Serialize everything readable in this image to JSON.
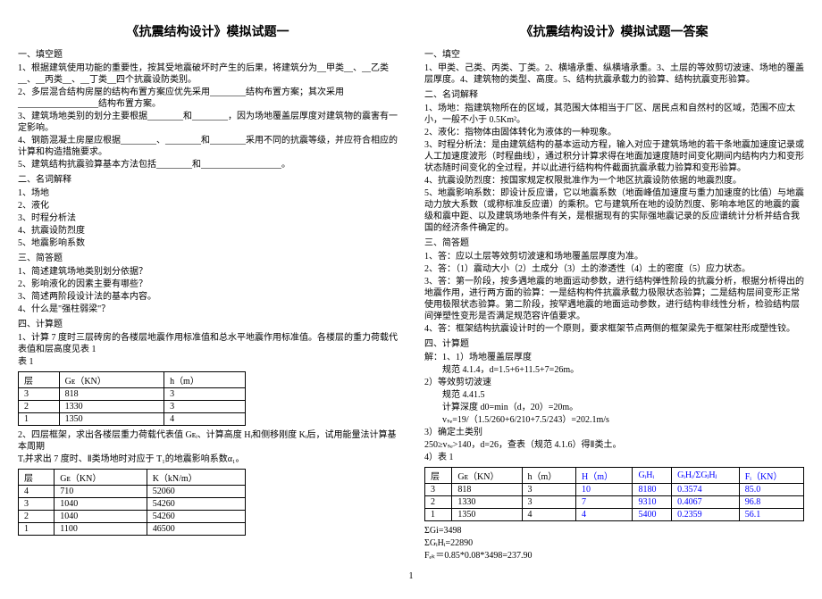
{
  "left": {
    "title": "《抗震结构设计》模拟试题一",
    "s1_title": "一、填空题",
    "q1_1": "1、根据建筑使用功能的重要性，按其受地震破坏时产生的后果，将建筑分为__甲类__、__乙类__、__丙类__、__丁类__四个抗震设防类别。",
    "q1_2": "2、多层混合结构房屋的结构布置方案应优先采用________结构布置方案；其次采用__________________结构布置方案。",
    "q1_3": "3、建筑场地类别的划分主要根据________和________，因为场地覆盖层厚度对建筑物的震害有一定影响。",
    "q1_4": "4、钢筋混凝土房屋应根据________、________和________采用不同的抗震等级，并应符合相应的计算和构造措施要求。",
    "q1_5": "5、建筑结构抗震验算基本方法包括________和__________________。",
    "s2_title": "二、名词解释",
    "q2_1": "1、场地",
    "q2_2": "2、液化",
    "q2_3": "3、时程分析法",
    "q2_4": "4、抗震设防烈度",
    "q2_5": "5、地震影响系数",
    "s3_title": "三、简答题",
    "q3_1": "1、简述建筑场地类别划分依据？",
    "q3_2": "2、影响液化的因素主要有哪些？",
    "q3_3": "3、简述两阶段设计法的基本内容。",
    "q3_4": "4、什么是\"强柱弱梁\"？",
    "s4_title": "四、计算题",
    "q4_1": "1、计算 7 度时三层砖房的各楼层地震作用标准值和总水平地震作用标准值。各楼层的重力荷载代表值和层高度见表 1",
    "t1_caption": "表 1",
    "table1": {
      "headers": [
        "层",
        "Gᴇ（KN）",
        "h（m）"
      ],
      "rows": [
        [
          "3",
          "818",
          "3"
        ],
        [
          "2",
          "1330",
          "3"
        ],
        [
          "1",
          "1350",
          "4"
        ]
      ]
    },
    "q4_2a": "2、四层框架，求出各楼层重力荷载代表值 Gᴇᵢ、计算高度 Hᵢ和侧移刚度 Kᵢ后，试用能量法计算基本周期",
    "q4_2b": "Tᵢ并求出 7 度时、Ⅱ类场地时对应于 T₁的地震影响系数α₁。",
    "table2": {
      "headers": [
        "层",
        "Gᴇ（KN）",
        "K（kN/m）"
      ],
      "rows": [
        [
          "4",
          "710",
          "52060"
        ],
        [
          "3",
          "1040",
          "54260"
        ],
        [
          "2",
          "1040",
          "54260"
        ],
        [
          "1",
          "1100",
          "46500"
        ]
      ]
    }
  },
  "right": {
    "title": "《抗震结构设计》模拟试题一答案",
    "s1_title": "一、填空",
    "a1_1": "1、甲类、己类、丙类、丁类。2、横墙承重、纵横墙承重。3、土层的等效剪切波速、场地的覆盖层厚度。4、建筑物的类型、高度。5、结构抗震承载力的验算、结构抗震变形验算。",
    "s2_title": "二、名词解释",
    "a2_1": "1、场地：指建筑物所在的区域，其范围大体相当于厂区、居民点和自然村的区域，范围不应太小，一般不小于 0.5Km²。",
    "a2_2": "2、液化：指物体由固体转化为液体的一种现象。",
    "a2_3": "3、时程分析法：是由建筑结构的基本运动方程，输入对应于建筑场地的若干条地震加速度记录或人工加速度波形（时程曲线），通过积分计算求得在地面加速度随时间变化期间内结构内力和变形状态随时间变化的全过程，并以此进行结构构件截面抗震承载力验算和变形验算。",
    "a2_4": "4、抗震设防烈度：按国家规定权限批准作为一个地区抗震设防依据的地震烈度。",
    "a2_5": "5、地震影响系数：即设计反应谱，它以地震系数（地面峰值加速度与重力加速度的比值）与地震动力放大系数（或称标准反应谱）的乘积。它与建筑所在地的设防烈度、影响本地区的地震的震级和震中距、以及建筑场地条件有关，是根据现有的实际强地震记录的反应谱统计分析并结合我国的经济条件确定的。",
    "s3_title": "三、简答题",
    "a3_1": "1、答：应以土层等效剪切波速和场地覆盖层厚度为准。",
    "a3_2": "2、答：（1）震动大小（2）土成分（3）土的渗透性（4）土的密度（5）应力状态。",
    "a3_3": "3、答：第一阶段，按多遇地震的地面运动参数，进行结构弹性阶段的抗震分析，根据分析得出的地震作用，进行两方面的验算：一是结构构件抗震承载力极限状态验算；二是结构层间变形正常使用极限状态验算。第二阶段，按罕遇地震的地面运动参数，进行结构非线性分析，检验结构层间弹塑性变形是否满足规范容许值要求。",
    "a3_4": "4、答：框架结构抗震设计时的一个原则，要求框架节点两侧的框架梁先于框架柱形成塑性铰。",
    "s4_title": "四、计算题",
    "a4_0": "解：1、1）场地覆盖层厚度",
    "a4_1": "规范 4.1.4，d=1.5+6+11.5+7=26m。",
    "a4_2a": "2）等效剪切波速",
    "a4_2b": "规范 4.41.5",
    "a4_2c": "计算深度 d0=min（d，20）=20m。",
    "a4_2d": "vₛₑ=19/（1.5/260+6/210+7.5/243）=202.1m/s",
    "a4_3a": "3）确定土类别",
    "a4_3b": "250≥vₛₑ>140，d=26，查表（规范 4.1.6）得Ⅱ类土。",
    "a4_4": "4）表 1",
    "table3": {
      "headers": [
        "层",
        "Gᴇ（KN）",
        "h（m）",
        "H（m）",
        "GᵢHᵢ",
        "GᵢHᵢ/ΣGⱼHⱼ",
        "Fᵢ（KN）"
      ],
      "rows": [
        [
          "3",
          "818",
          "3",
          "10",
          "8180",
          "0.3574",
          "85.0"
        ],
        [
          "2",
          "1330",
          "3",
          "7",
          "9310",
          "0.4067",
          "96.8"
        ],
        [
          "1",
          "1350",
          "4",
          "4",
          "5400",
          "0.2359",
          "56.1"
        ]
      ]
    },
    "a4_5": "ΣGi=3498",
    "a4_6": "ΣGᵢHᵢ=22890",
    "a4_7": "Fₑₖ＝0.85*0.08*3498=237.90"
  },
  "page_number": "1"
}
